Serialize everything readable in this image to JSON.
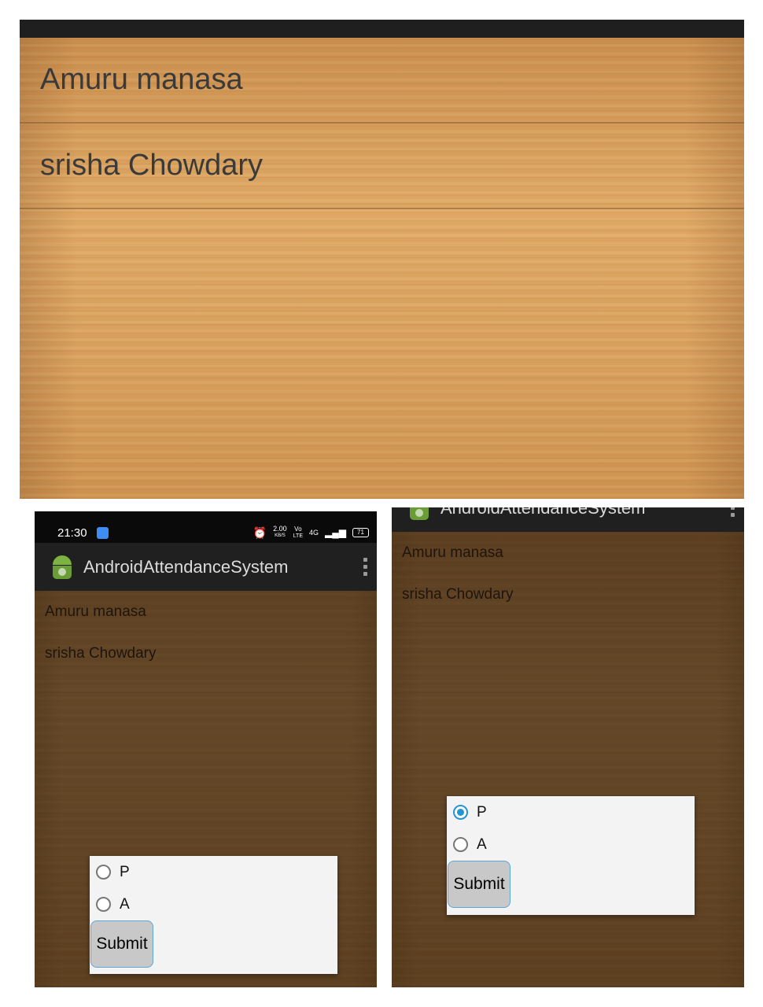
{
  "zoomed_view": {
    "students": [
      "Amuru manasa",
      "srisha Chowdary"
    ]
  },
  "left_screen": {
    "status_bar": {
      "time": "21:30",
      "speed": "2.00",
      "speed_unit": "KB/S",
      "volte_top": "Vo",
      "volte_bottom": "LTE",
      "network": "4G",
      "battery": "71"
    },
    "app_title": "AndroidAttendanceSystem",
    "students": [
      "Amuru manasa",
      "srisha Chowdary"
    ],
    "dialog": {
      "options": [
        "P",
        "A"
      ],
      "selected": "",
      "submit_label": "Submit"
    }
  },
  "right_screen": {
    "app_title": "AndroidAttendanceSystem",
    "students": [
      "Amuru manasa",
      "srisha Chowdary"
    ],
    "dialog": {
      "options": [
        "P",
        "A"
      ],
      "selected": "P",
      "submit_label": "Submit"
    }
  },
  "colors": {
    "accent": "#2196d3",
    "action_bar": "#202020",
    "status_bar": "#0a0a0a",
    "wood": "#d89e5c"
  }
}
